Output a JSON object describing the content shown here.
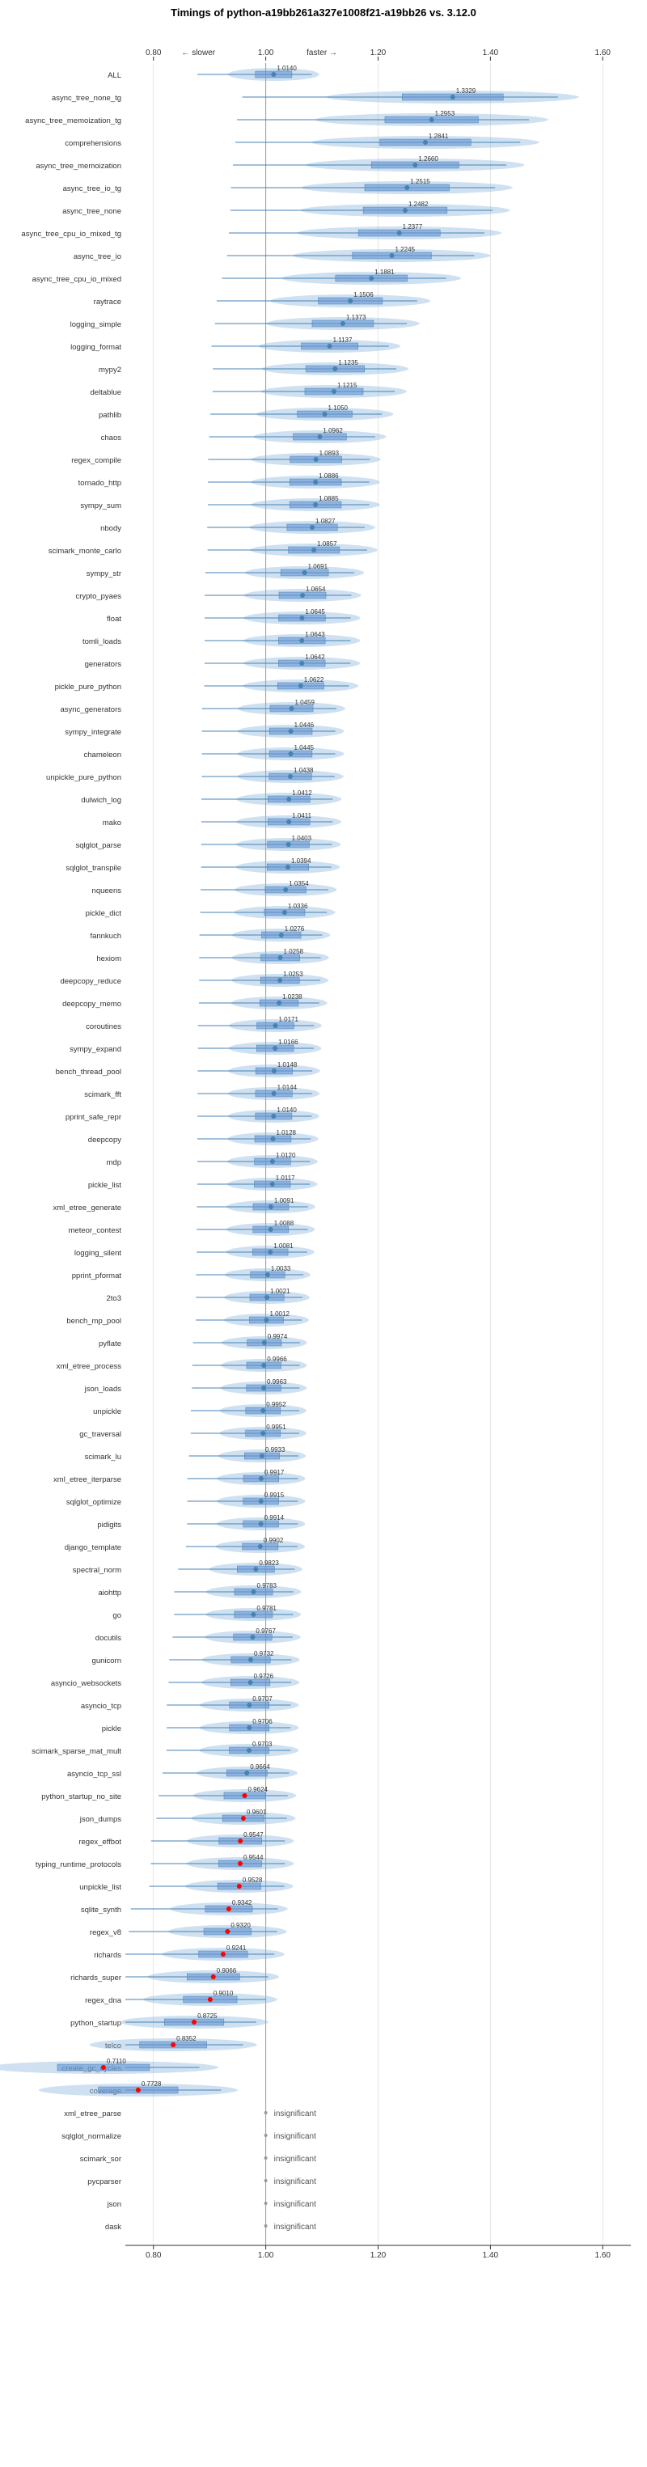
{
  "title": "Timings of python-a19bb261a327e1008f21-a19bb26 vs. 3.12.0",
  "x_axis": {
    "min": 0.8,
    "max": 1.6,
    "ticks": [
      0.8,
      1.0,
      1.2,
      1.4,
      1.6
    ],
    "label_left": "← slower",
    "label_right": "faster →"
  },
  "rows": [
    {
      "label": "ALL",
      "value": 1.014,
      "color": "blue"
    },
    {
      "label": "async_tree_none_tg",
      "value": 1.3329,
      "color": "blue"
    },
    {
      "label": "async_tree_memoization_tg",
      "value": 1.2953,
      "color": "blue"
    },
    {
      "label": "comprehensions",
      "value": 1.2841,
      "color": "blue"
    },
    {
      "label": "async_tree_memoization",
      "value": 1.266,
      "color": "blue"
    },
    {
      "label": "async_tree_io_tg",
      "value": 1.2515,
      "color": "blue"
    },
    {
      "label": "async_tree_none",
      "value": 1.2482,
      "color": "blue"
    },
    {
      "label": "async_tree_cpu_io_mixed_tg",
      "value": 1.2377,
      "color": "blue"
    },
    {
      "label": "async_tree_io",
      "value": 1.2245,
      "color": "blue"
    },
    {
      "label": "async_tree_cpu_io_mixed",
      "value": 1.1881,
      "color": "blue"
    },
    {
      "label": "raytrace",
      "value": 1.1506,
      "color": "blue"
    },
    {
      "label": "logging_simple",
      "value": 1.1373,
      "color": "blue"
    },
    {
      "label": "logging_format",
      "value": 1.1137,
      "color": "blue"
    },
    {
      "label": "mypy2",
      "value": 1.1235,
      "color": "blue"
    },
    {
      "label": "deltablue",
      "value": 1.1215,
      "color": "blue"
    },
    {
      "label": "pathlib",
      "value": 1.105,
      "color": "blue"
    },
    {
      "label": "chaos",
      "value": 1.0962,
      "color": "blue"
    },
    {
      "label": "regex_compile",
      "value": 1.0893,
      "color": "blue"
    },
    {
      "label": "tornado_http",
      "value": 1.0886,
      "color": "blue"
    },
    {
      "label": "sympy_sum",
      "value": 1.0885,
      "color": "blue"
    },
    {
      "label": "nbody",
      "value": 1.0827,
      "color": "blue"
    },
    {
      "label": "scimark_monte_carlo",
      "value": 1.0857,
      "color": "blue"
    },
    {
      "label": "sympy_str",
      "value": 1.0691,
      "color": "blue"
    },
    {
      "label": "crypto_pyaes",
      "value": 1.0654,
      "color": "blue"
    },
    {
      "label": "float",
      "value": 1.0645,
      "color": "blue"
    },
    {
      "label": "tomli_loads",
      "value": 1.0643,
      "color": "blue"
    },
    {
      "label": "generators",
      "value": 1.0642,
      "color": "blue"
    },
    {
      "label": "pickle_pure_python",
      "value": 1.0622,
      "color": "blue"
    },
    {
      "label": "async_generators",
      "value": 1.0459,
      "color": "blue"
    },
    {
      "label": "sympy_integrate",
      "value": 1.0446,
      "color": "blue"
    },
    {
      "label": "chameleon",
      "value": 1.0445,
      "color": "blue"
    },
    {
      "label": "unpickle_pure_python",
      "value": 1.0438,
      "color": "blue"
    },
    {
      "label": "dulwich_log",
      "value": 1.0412,
      "color": "blue"
    },
    {
      "label": "mako",
      "value": 1.0411,
      "color": "blue"
    },
    {
      "label": "sqlglot_parse",
      "value": 1.0403,
      "color": "blue"
    },
    {
      "label": "sqlglot_transpile",
      "value": 1.0394,
      "color": "blue"
    },
    {
      "label": "nqueens",
      "value": 1.0354,
      "color": "blue"
    },
    {
      "label": "pickle_dict",
      "value": 1.0336,
      "color": "blue"
    },
    {
      "label": "fannkuch",
      "value": 1.0276,
      "color": "blue"
    },
    {
      "label": "hexiom",
      "value": 1.0258,
      "color": "blue"
    },
    {
      "label": "deepcopy_reduce",
      "value": 1.0253,
      "color": "blue"
    },
    {
      "label": "deepcopy_memo",
      "value": 1.0238,
      "color": "blue"
    },
    {
      "label": "coroutines",
      "value": 1.0171,
      "color": "blue"
    },
    {
      "label": "sympy_expand",
      "value": 1.0166,
      "color": "blue"
    },
    {
      "label": "bench_thread_pool",
      "value": 1.0148,
      "color": "blue"
    },
    {
      "label": "scimark_fft",
      "value": 1.0144,
      "color": "blue"
    },
    {
      "label": "pprint_safe_repr",
      "value": 1.014,
      "color": "blue"
    },
    {
      "label": "deepcopy",
      "value": 1.0128,
      "color": "blue"
    },
    {
      "label": "mdp",
      "value": 1.012,
      "color": "blue"
    },
    {
      "label": "pickle_list",
      "value": 1.0117,
      "color": "blue"
    },
    {
      "label": "xml_etree_generate",
      "value": 1.0091,
      "color": "blue"
    },
    {
      "label": "meteor_contest",
      "value": 1.0088,
      "color": "blue"
    },
    {
      "label": "logging_silent",
      "value": 1.0081,
      "color": "blue"
    },
    {
      "label": "pprint_pformat",
      "value": 1.0033,
      "color": "blue"
    },
    {
      "label": "2to3",
      "value": 1.0021,
      "color": "blue"
    },
    {
      "label": "bench_mp_pool",
      "value": 1.0012,
      "color": "blue"
    },
    {
      "label": "pyflate",
      "value": 0.9974,
      "color": "blue"
    },
    {
      "label": "xml_etree_process",
      "value": 0.9966,
      "color": "blue"
    },
    {
      "label": "json_loads",
      "value": 0.9963,
      "color": "blue"
    },
    {
      "label": "unpickle",
      "value": 0.9952,
      "color": "blue"
    },
    {
      "label": "gc_traversal",
      "value": 0.9951,
      "color": "blue"
    },
    {
      "label": "scimark_lu",
      "value": 0.9933,
      "color": "blue"
    },
    {
      "label": "xml_etree_iterparse",
      "value": 0.9917,
      "color": "blue"
    },
    {
      "label": "sqlglot_optimize",
      "value": 0.9915,
      "color": "blue"
    },
    {
      "label": "pidigits",
      "value": 0.9914,
      "color": "blue"
    },
    {
      "label": "django_template",
      "value": 0.9902,
      "color": "blue"
    },
    {
      "label": "spectral_norm",
      "value": 0.9823,
      "color": "blue"
    },
    {
      "label": "aiohttp",
      "value": 0.9783,
      "color": "blue"
    },
    {
      "label": "go",
      "value": 0.9781,
      "color": "blue"
    },
    {
      "label": "docutils",
      "value": 0.9767,
      "color": "blue"
    },
    {
      "label": "gunicorn",
      "value": 0.9732,
      "color": "blue"
    },
    {
      "label": "asyncio_websockets",
      "value": 0.9726,
      "color": "blue"
    },
    {
      "label": "asyncio_tcp",
      "value": 0.9707,
      "color": "blue"
    },
    {
      "label": "pickle",
      "value": 0.9706,
      "color": "blue"
    },
    {
      "label": "scimark_sparse_mat_mult",
      "value": 0.9703,
      "color": "blue"
    },
    {
      "label": "asyncio_tcp_ssl",
      "value": 0.9664,
      "color": "blue"
    },
    {
      "label": "python_startup_no_site",
      "value": 0.9624,
      "color": "blue"
    },
    {
      "label": "json_dumps",
      "value": 0.9601,
      "color": "blue"
    },
    {
      "label": "regex_effbot",
      "value": 0.9547,
      "color": "blue"
    },
    {
      "label": "typing_runtime_protocols",
      "value": 0.9544,
      "color": "blue"
    },
    {
      "label": "unpickle_list",
      "value": 0.9528,
      "color": "blue"
    },
    {
      "label": "sqlite_synth",
      "value": 0.9342,
      "color": "blue"
    },
    {
      "label": "regex_v8",
      "value": 0.932,
      "color": "blue"
    },
    {
      "label": "richards",
      "value": 0.9241,
      "color": "blue"
    },
    {
      "label": "richards_super",
      "value": 0.9066,
      "color": "blue"
    },
    {
      "label": "regex_dna",
      "value": 0.901,
      "color": "blue"
    },
    {
      "label": "python_startup",
      "value": 0.8725,
      "color": "blue"
    },
    {
      "label": "telco",
      "value": 0.8352,
      "color": "blue"
    },
    {
      "label": "create_gc_cycles",
      "value": 0.711,
      "color": "blue"
    },
    {
      "label": "coverage",
      "value": 0.7728,
      "color": "blue"
    },
    {
      "label": "xml_etree_parse",
      "value": null,
      "label2": "insignificant"
    },
    {
      "label": "sqlglot_normalize",
      "value": null,
      "label2": "insignificant"
    },
    {
      "label": "scimark_sor",
      "value": null,
      "label2": "insignificant"
    },
    {
      "label": "pycparser",
      "value": null,
      "label2": "insignificant"
    },
    {
      "label": "json",
      "value": null,
      "label2": "insignificant"
    },
    {
      "label": "dask",
      "value": null,
      "label2": "insignificant"
    }
  ]
}
